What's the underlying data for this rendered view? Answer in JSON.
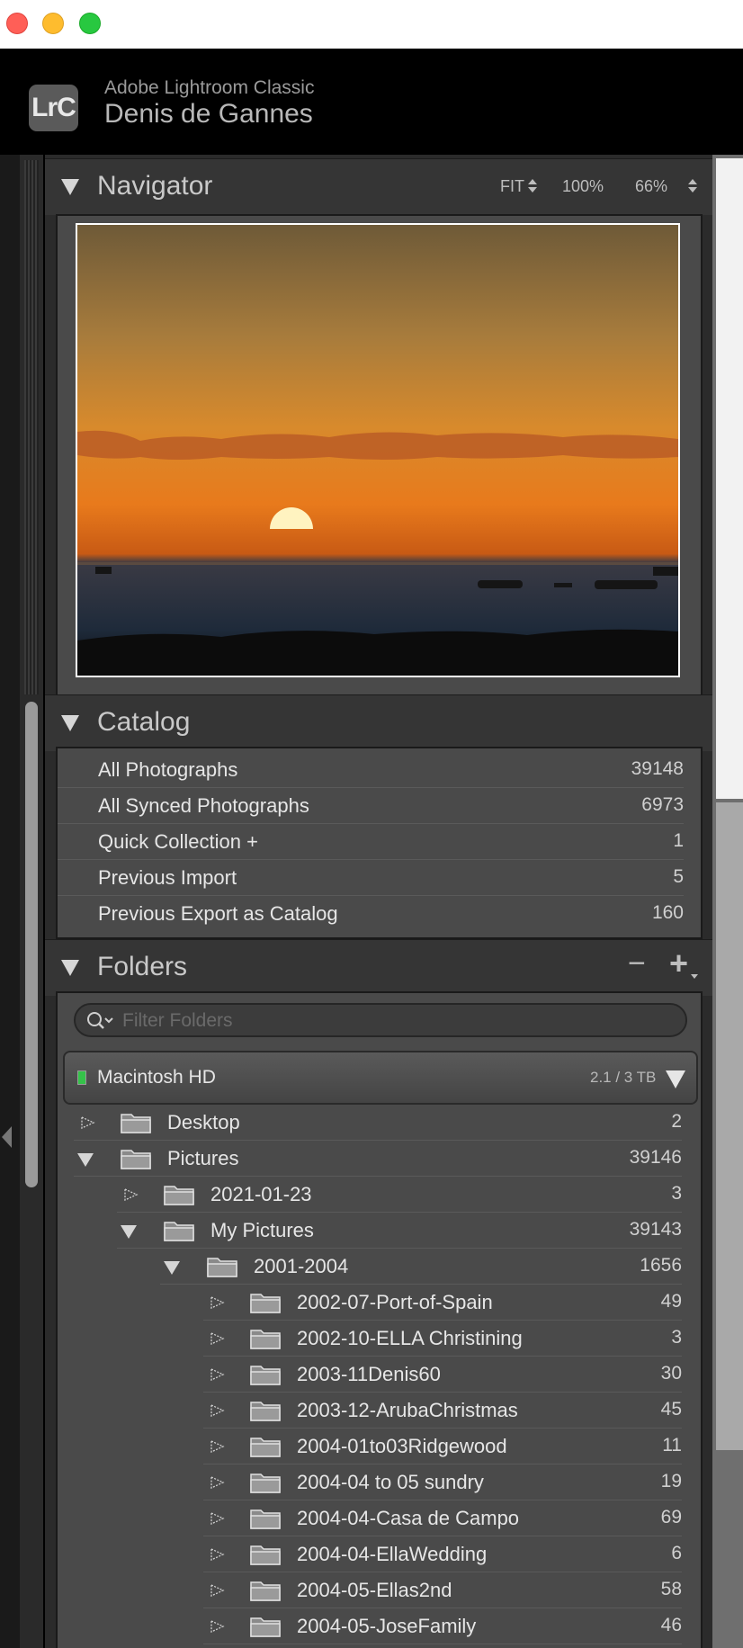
{
  "header": {
    "app_name": "Adobe Lightroom Classic",
    "user_name": "Denis de Gannes",
    "logo_text": "LrC"
  },
  "navigator": {
    "title": "Navigator",
    "fit_label": "FIT",
    "zoom_100": "100%",
    "zoom_custom": "66%"
  },
  "catalog": {
    "title": "Catalog",
    "items": [
      {
        "label": "All Photographs",
        "count": "39148"
      },
      {
        "label": "All Synced Photographs",
        "count": "6973"
      },
      {
        "label": "Quick Collection +",
        "count": "1"
      },
      {
        "label": "Previous Import",
        "count": "5"
      },
      {
        "label": "Previous Export as Catalog",
        "count": "160"
      }
    ]
  },
  "folders": {
    "title": "Folders",
    "minus": "−",
    "plus": "+",
    "filter_placeholder": "Filter Folders",
    "volume": {
      "name": "Macintosh HD",
      "usage": "2.1 / 3 TB",
      "status_color": "#35c24a"
    },
    "items": [
      {
        "label": "Desktop",
        "count": "2",
        "level": 0,
        "expanded": false
      },
      {
        "label": "Pictures",
        "count": "39146",
        "level": 0,
        "expanded": true
      },
      {
        "label": "2021-01-23",
        "count": "3",
        "level": 1,
        "expanded": false
      },
      {
        "label": "My Pictures",
        "count": "39143",
        "level": 1,
        "expanded": true
      },
      {
        "label": "2001-2004",
        "count": "1656",
        "level": 2,
        "expanded": true
      },
      {
        "label": "2002-07-Port-of-Spain",
        "count": "49",
        "level": 3,
        "expanded": false
      },
      {
        "label": "2002-10-ELLA Christining",
        "count": "3",
        "level": 3,
        "expanded": false
      },
      {
        "label": "2003-11Denis60",
        "count": "30",
        "level": 3,
        "expanded": false
      },
      {
        "label": "2003-12-ArubaChristmas",
        "count": "45",
        "level": 3,
        "expanded": false
      },
      {
        "label": "2004-01to03Ridgewood",
        "count": "11",
        "level": 3,
        "expanded": false
      },
      {
        "label": "2004-04 to 05 sundry",
        "count": "19",
        "level": 3,
        "expanded": false
      },
      {
        "label": "2004-04-Casa de Campo",
        "count": "69",
        "level": 3,
        "expanded": false
      },
      {
        "label": "2004-04-EllaWedding",
        "count": "6",
        "level": 3,
        "expanded": false
      },
      {
        "label": "2004-05-Ellas2nd",
        "count": "58",
        "level": 3,
        "expanded": false
      },
      {
        "label": "2004-05-JoseFamily",
        "count": "46",
        "level": 3,
        "expanded": false
      }
    ]
  },
  "icons": {
    "disclosure_open": "triangle-down-icon",
    "disclosure_closed": "triangle-right-icon",
    "folder": "folder-icon",
    "search": "search-icon"
  }
}
